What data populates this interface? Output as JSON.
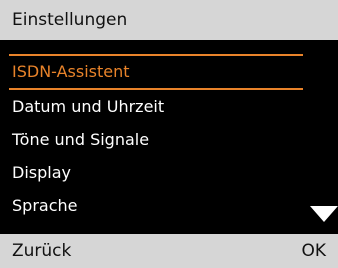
{
  "header": {
    "title": "Einstellungen"
  },
  "menu": {
    "items": [
      {
        "label": "ISDN-Assistent",
        "selected": true
      },
      {
        "label": "Datum und Uhrzeit",
        "selected": false
      },
      {
        "label": "Töne und Signale",
        "selected": false
      },
      {
        "label": "Display",
        "selected": false
      },
      {
        "label": "Sprache",
        "selected": false
      }
    ],
    "scroll_icon": "triangle-down-icon"
  },
  "softkeys": {
    "left_label": "Zurück",
    "right_label": "OK"
  },
  "colors": {
    "screen_bg": "#000000",
    "bar_bg": "#d6d6d6",
    "accent": "#e8832a",
    "text_on_dark": "#ffffff",
    "text_on_light": "#111111"
  }
}
